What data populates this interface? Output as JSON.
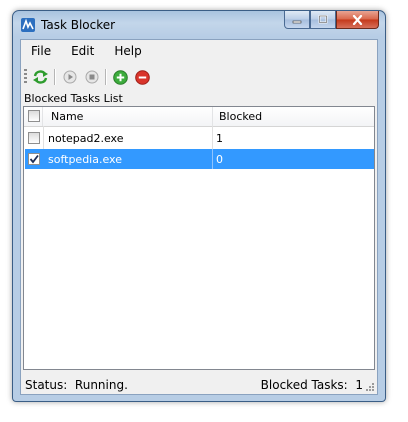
{
  "window": {
    "title": "Task Blocker",
    "caption_buttons": [
      "minimize",
      "maximize",
      "close"
    ]
  },
  "menu": [
    {
      "label": "File"
    },
    {
      "label": "Edit"
    },
    {
      "label": "Help"
    }
  ],
  "toolbar": {
    "buttons": [
      {
        "icon": "refresh-icon"
      },
      {
        "icon": "play-icon"
      },
      {
        "icon": "stop-icon"
      },
      {
        "icon": "add-icon"
      },
      {
        "icon": "remove-icon"
      }
    ]
  },
  "list": {
    "label": "Blocked Tasks List",
    "columns": [
      "Name",
      "Blocked"
    ],
    "rows": [
      {
        "name": "notepad2.exe",
        "blocked": "1",
        "checked": false,
        "selected": false
      },
      {
        "name": "softpedia.exe",
        "blocked": "0",
        "checked": true,
        "selected": true
      }
    ]
  },
  "status": {
    "label": "Status:",
    "value": "Running.",
    "count_label": "Blocked Tasks:",
    "count_value": "1"
  },
  "colors": {
    "selection": "#3399ff",
    "add": "#3cab3c",
    "remove": "#d9342b"
  }
}
